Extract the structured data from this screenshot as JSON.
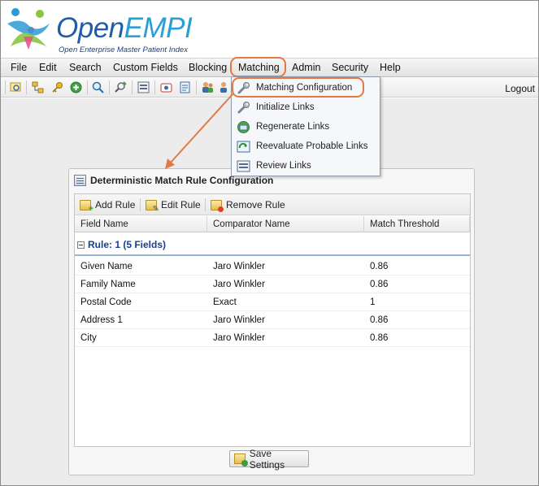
{
  "app": {
    "logo_open": "Open",
    "logo_empi": "EMPI",
    "logo_subtitle": "Open Enterprise Master Patient Index"
  },
  "menubar": {
    "items": [
      "File",
      "Edit",
      "Search",
      "Custom Fields",
      "Blocking",
      "Matching",
      "Admin",
      "Security",
      "Help"
    ],
    "active": "Matching"
  },
  "toolbar": {
    "logout_label": "Logout"
  },
  "matching_menu": {
    "items": [
      {
        "label": "Matching Configuration",
        "icon": "wrench-icon"
      },
      {
        "label": "Initialize Links",
        "icon": "wrench-icon"
      },
      {
        "label": "Regenerate Links",
        "icon": "regenerate-icon"
      },
      {
        "label": "Reevaluate Probable Links",
        "icon": "reevaluate-icon"
      },
      {
        "label": "Review Links",
        "icon": "review-icon"
      }
    ]
  },
  "panel": {
    "title": "Deterministic Match Rule Configuration",
    "add_rule": "Add Rule",
    "edit_rule": "Edit Rule",
    "remove_rule": "Remove Rule",
    "columns": [
      "Field Name",
      "Comparator Name",
      "Match Threshold"
    ],
    "group_label": "Rule: 1 (5 Fields)",
    "rows": [
      {
        "field": "Given Name",
        "comparator": "Jaro Winkler",
        "threshold": "0.86"
      },
      {
        "field": "Family Name",
        "comparator": "Jaro Winkler",
        "threshold": "0.86"
      },
      {
        "field": "Postal Code",
        "comparator": "Exact",
        "threshold": "1"
      },
      {
        "field": "Address 1",
        "comparator": "Jaro Winkler",
        "threshold": "0.86"
      },
      {
        "field": "City",
        "comparator": "Jaro Winkler",
        "threshold": "0.86"
      }
    ],
    "save_label": "Save Settings"
  },
  "colors": {
    "highlight": "#e37a45",
    "group_text": "#15428b",
    "logo_dark": "#1f5da8",
    "logo_light": "#2a9fd6"
  }
}
